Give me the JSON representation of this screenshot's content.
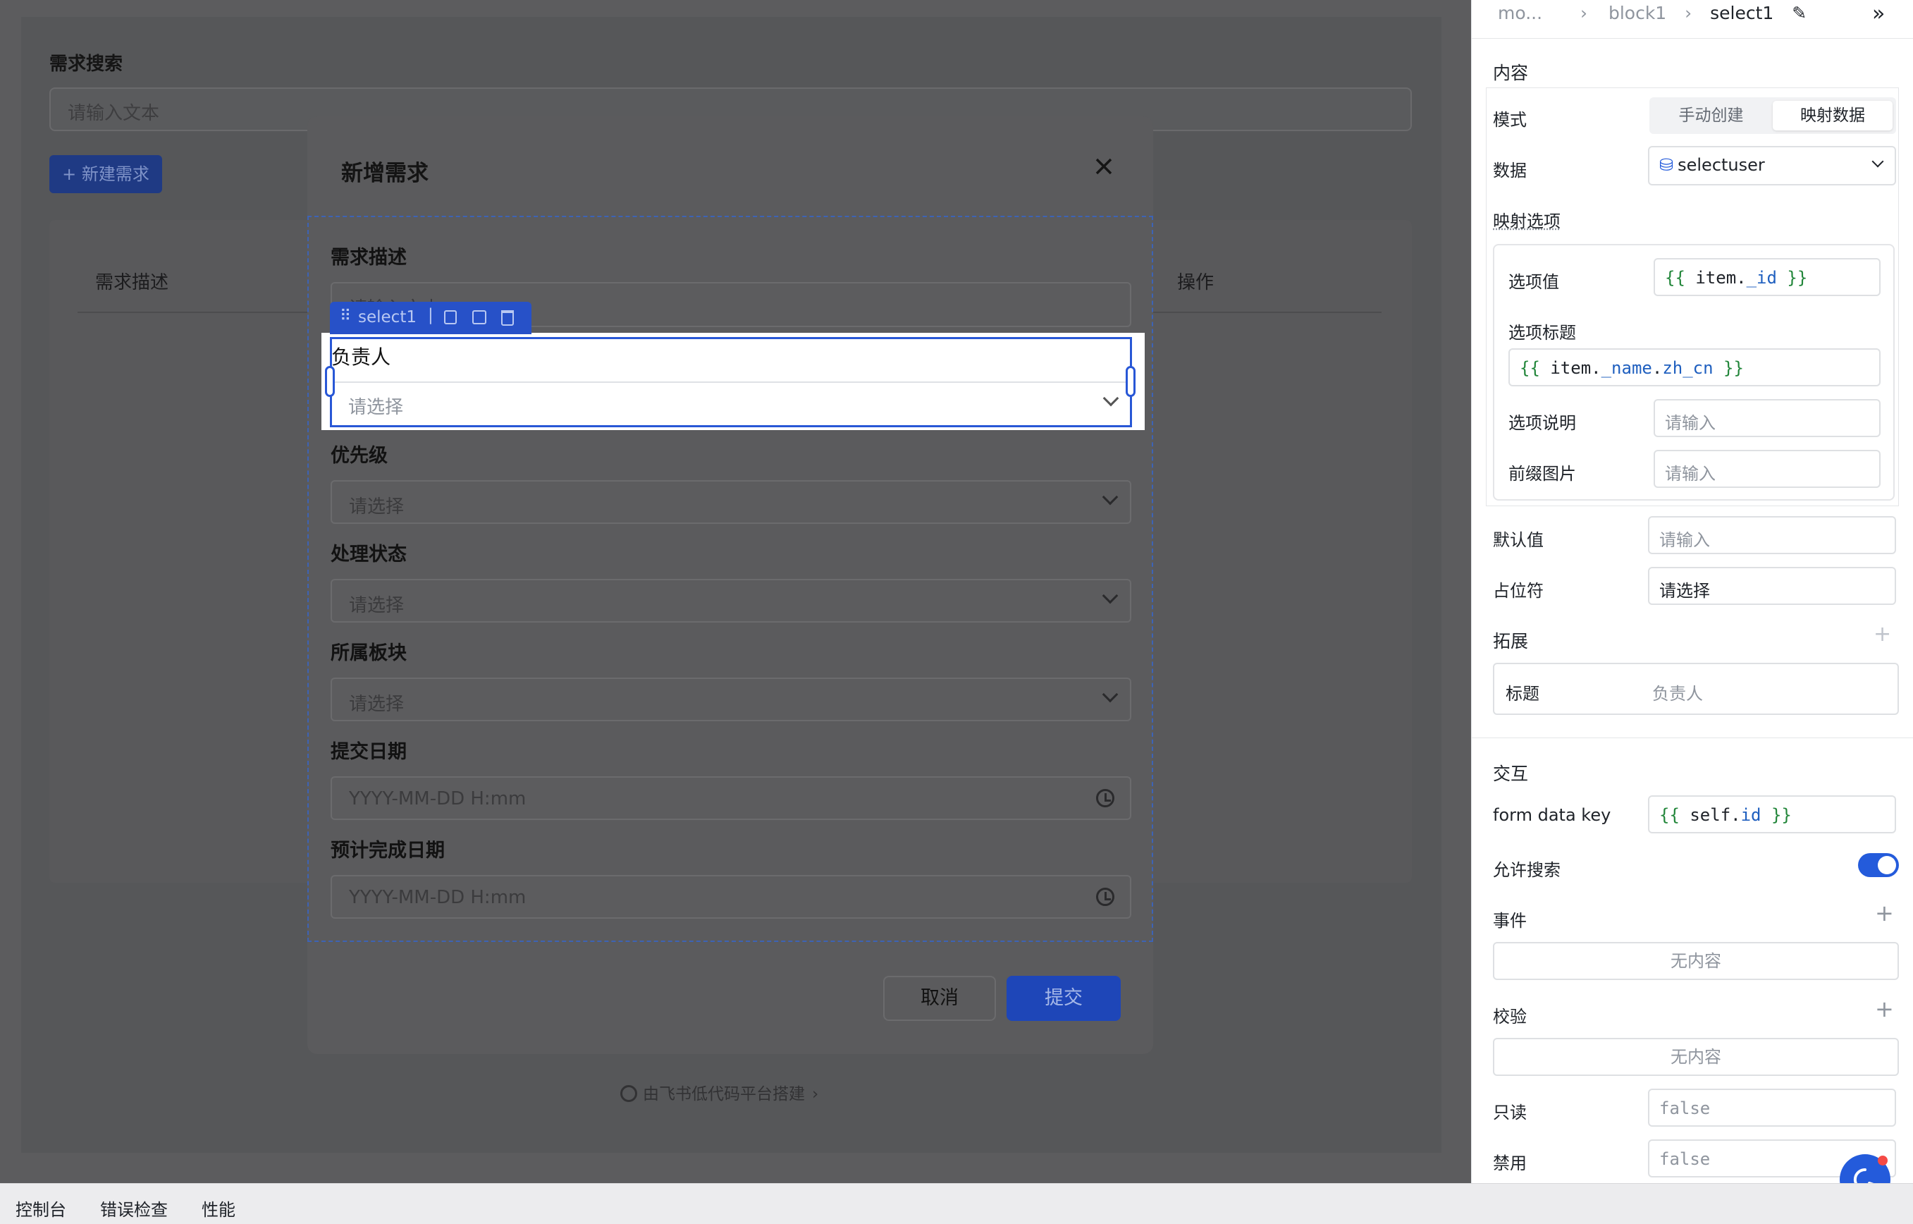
{
  "background_page": {
    "search_title": "需求搜索",
    "search_placeholder": "请输入文本",
    "new_button": "+ 新建需求",
    "table_headers": [
      "需求描述",
      "操作"
    ],
    "footer_text": "由飞书低代码平台搭建"
  },
  "modal": {
    "title": "新增需求",
    "fields": [
      {
        "label": "需求描述",
        "placeholder": "请输入文本"
      },
      {
        "label": "负责人",
        "placeholder": "请选择"
      },
      {
        "label": "优先级",
        "placeholder": "请选择"
      },
      {
        "label": "处理状态",
        "placeholder": "请选择"
      },
      {
        "label": "所属板块",
        "placeholder": "请选择"
      },
      {
        "label": "提交日期",
        "placeholder": "YYYY-MM-DD H:mm"
      },
      {
        "label": "预计完成日期",
        "placeholder": "YYYY-MM-DD H:mm"
      }
    ],
    "selected_component": "select1",
    "cancel_label": "取消",
    "submit_label": "提交"
  },
  "right_panel": {
    "breadcrumb": [
      "mo...",
      "block1",
      "select1"
    ],
    "content_section": "内容",
    "mode_label": "模式",
    "mode_options": [
      "手动创建",
      "映射数据"
    ],
    "mode_selected": "映射数据",
    "data_label": "数据",
    "data_value": "selectuser",
    "mapping_label": "映射选项",
    "option_value_label": "选项值",
    "option_value_code": {
      "open": "{{ ",
      "obj": "item.",
      "prop": "_id",
      "close": " }}"
    },
    "option_title_label": "选项标题",
    "option_title_code": {
      "open": "{{ ",
      "obj": "item.",
      "prop": "_name",
      "dot": ".",
      "prop2": "zh_cn",
      "close": " }}"
    },
    "option_desc_label": "选项说明",
    "option_desc_placeholder": "请输入",
    "prefix_img_label": "前缀图片",
    "prefix_img_placeholder": "请输入",
    "default_label": "默认值",
    "default_placeholder": "请输入",
    "placeholder_label": "占位符",
    "placeholder_value": "请选择",
    "extend_section": "拓展",
    "title_label": "标题",
    "title_value": "负责人",
    "interact_section": "交互",
    "form_key_label": "form data key",
    "form_key_code": {
      "open": "{{ ",
      "obj": "self.",
      "prop": "id",
      "close": " }}"
    },
    "allow_search_label": "允许搜索",
    "allow_search": true,
    "events_label": "事件",
    "events_empty": "无内容",
    "validate_label": "校验",
    "validate_empty": "无内容",
    "readonly_label": "只读",
    "readonly_value": "false",
    "disabled_label": "禁用",
    "disabled_value": "false"
  },
  "bottom_tabs": [
    "控制台",
    "错误检查",
    "性能"
  ],
  "colors": {
    "accent": "#245bdb",
    "code_green": "#22863a",
    "overlay": "#565759"
  }
}
